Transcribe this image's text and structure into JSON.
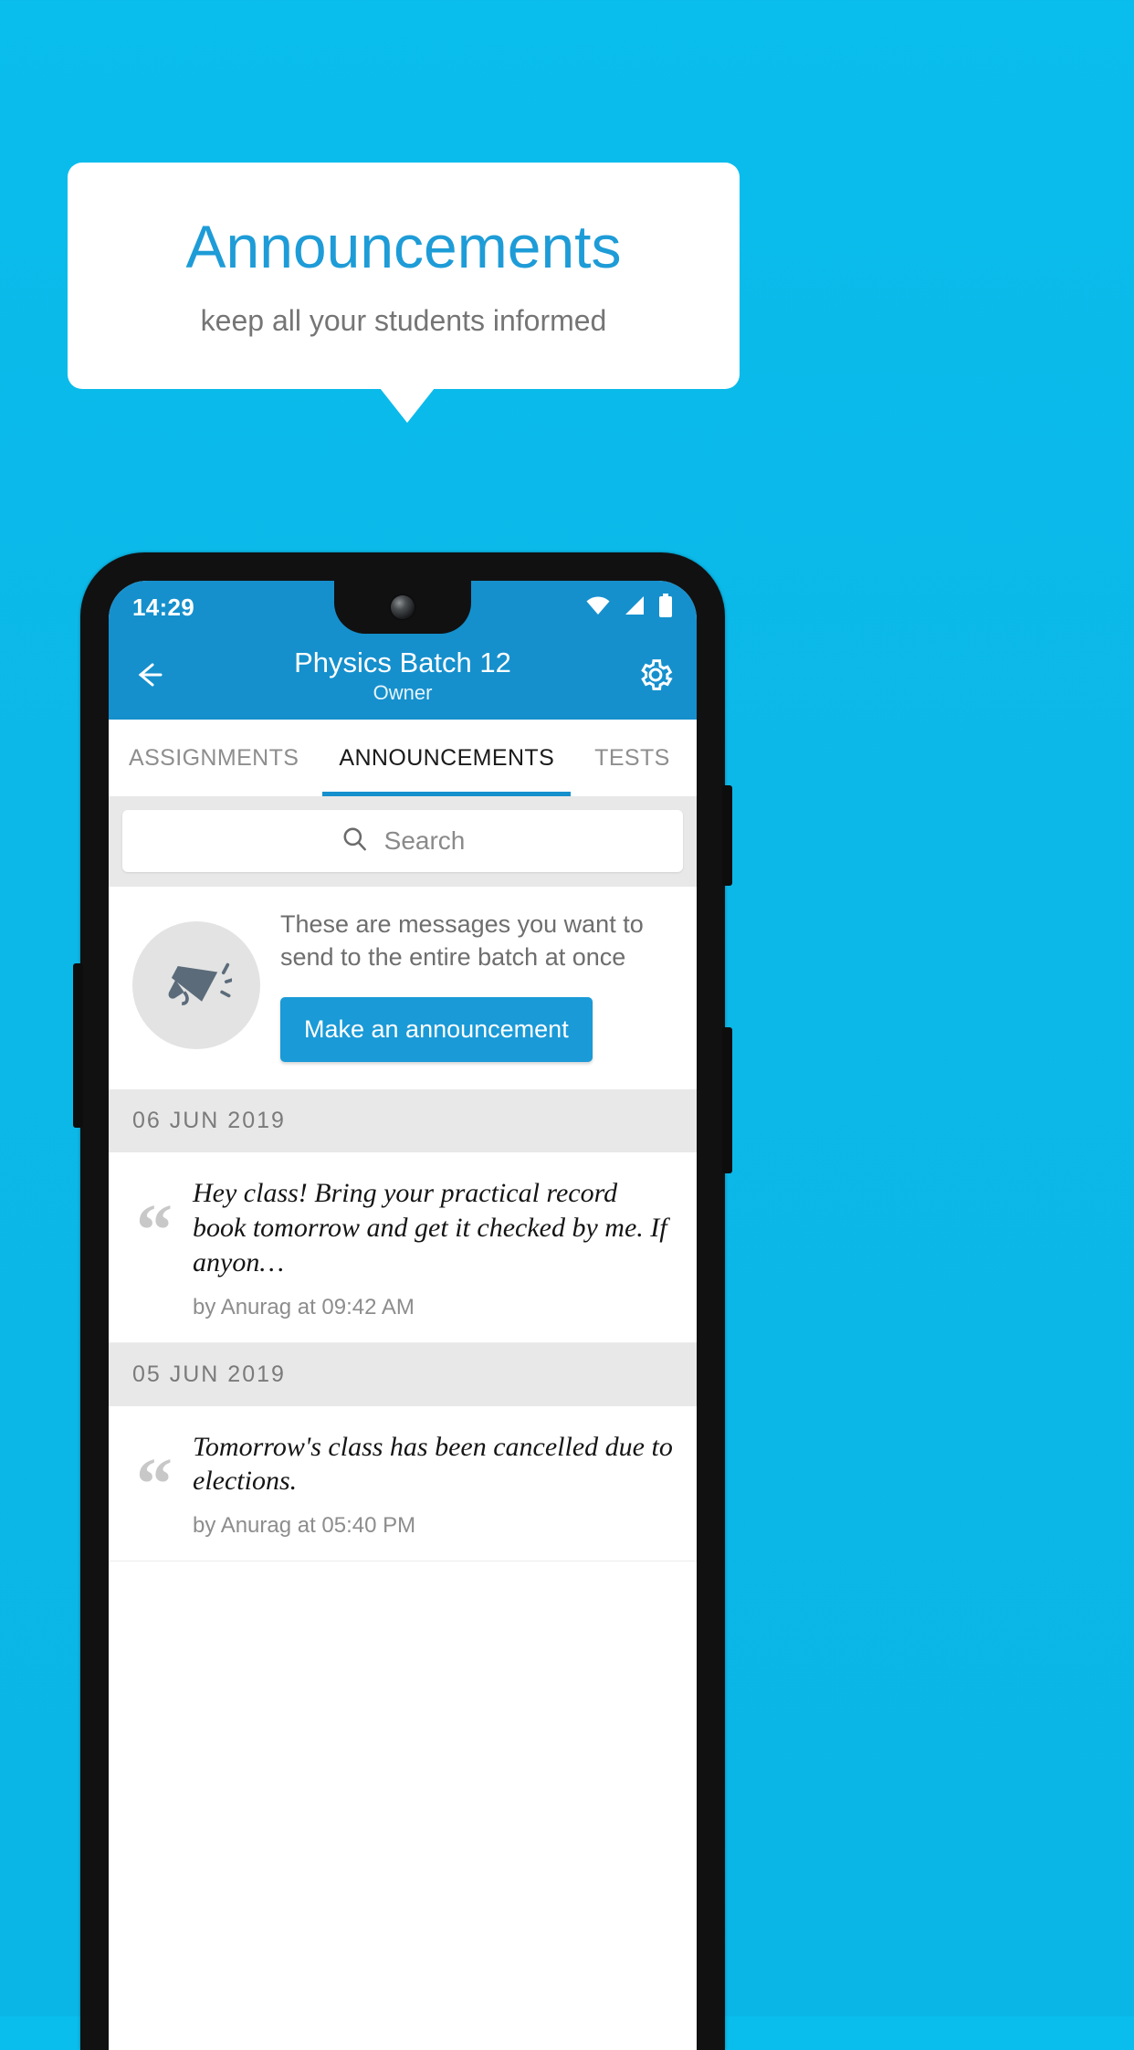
{
  "promo": {
    "title": "Announcements",
    "subtitle": "keep all your students informed",
    "title_color": "#1e9cd7",
    "background_color": "#0ab8e9"
  },
  "phone": {
    "status_bar": {
      "time": "14:29",
      "icons": [
        "wifi-icon",
        "cellular-signal-icon",
        "battery-icon"
      ]
    },
    "app_bar": {
      "back_icon": "arrow-left-icon",
      "title": "Physics Batch 12",
      "subtitle": "Owner",
      "settings_icon": "gear-icon",
      "background_color": "#1590cd"
    },
    "tabs": [
      {
        "label": "ASSIGNMENTS",
        "active": false
      },
      {
        "label": "ANNOUNCEMENTS",
        "active": true
      },
      {
        "label": "TESTS",
        "active": false
      },
      {
        "label": "’",
        "active": false
      }
    ],
    "search": {
      "icon": "search-icon",
      "placeholder": "Search",
      "value": ""
    },
    "empty_state": {
      "icon": "megaphone-icon",
      "text": "These are messages you want to send to the entire batch at once",
      "button_label": "Make an announcement",
      "button_color": "#1a9ad7"
    },
    "groups": [
      {
        "date": "06  JUN  2019",
        "items": [
          {
            "quote_icon": "quote-icon",
            "text": "Hey class! Bring your practical record book tomorrow and get it checked by me. If anyon…",
            "meta": "by Anurag at 09:42 AM"
          }
        ]
      },
      {
        "date": "05  JUN  2019",
        "items": [
          {
            "quote_icon": "quote-icon",
            "text": "Tomorrow's class has been cancelled due to elections.",
            "meta": "by Anurag at 05:40 PM"
          }
        ]
      }
    ]
  }
}
